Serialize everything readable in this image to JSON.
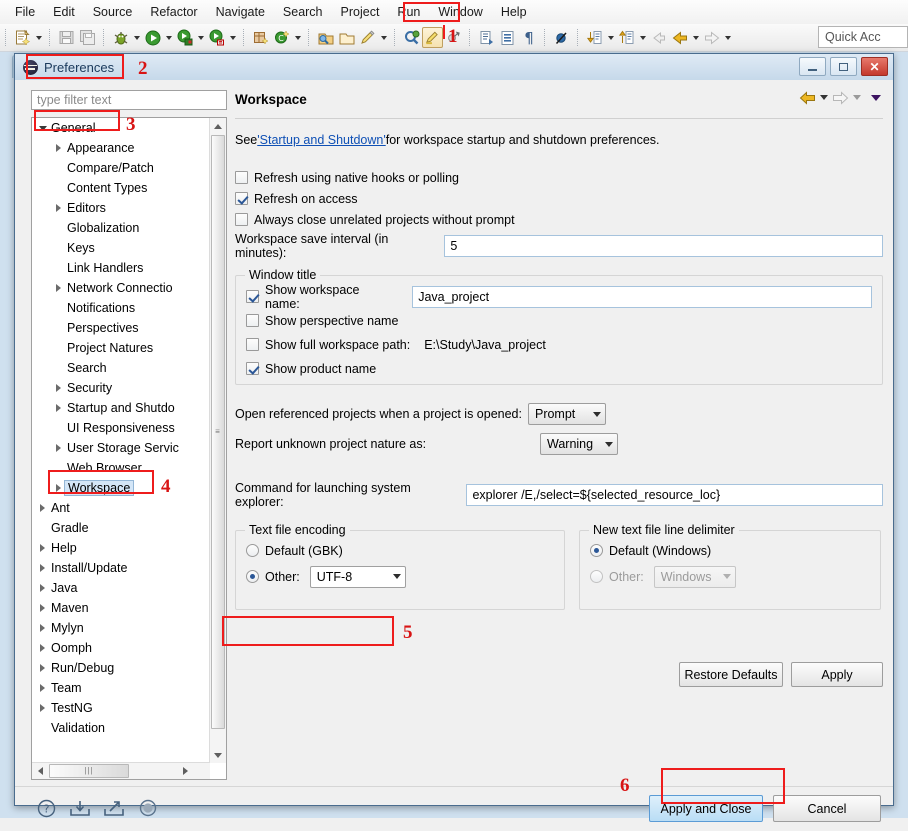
{
  "app": {
    "menubar": [
      "File",
      "Edit",
      "Source",
      "Refactor",
      "Navigate",
      "Search",
      "Project",
      "Run",
      "Window",
      "Help"
    ],
    "quick_access": "Quick Acc"
  },
  "dialog": {
    "title": "Preferences",
    "logo_icon": "eclipse-logo-icon",
    "minimize_label": "minimize-icon",
    "maximize_label": "maximize-icon",
    "close_label": "✕"
  },
  "filter": {
    "placeholder": "type filter text",
    "value": ""
  },
  "tree": {
    "items": [
      {
        "label": "General",
        "indent": 0,
        "arrow": "open",
        "selected": false
      },
      {
        "label": "Appearance",
        "indent": 1,
        "arrow": "closed",
        "selected": false
      },
      {
        "label": "Compare/Patch",
        "indent": 1,
        "arrow": "none",
        "selected": false
      },
      {
        "label": "Content Types",
        "indent": 1,
        "arrow": "none",
        "selected": false
      },
      {
        "label": "Editors",
        "indent": 1,
        "arrow": "closed",
        "selected": false
      },
      {
        "label": "Globalization",
        "indent": 1,
        "arrow": "none",
        "selected": false
      },
      {
        "label": "Keys",
        "indent": 1,
        "arrow": "none",
        "selected": false
      },
      {
        "label": "Link Handlers",
        "indent": 1,
        "arrow": "none",
        "selected": false
      },
      {
        "label": "Network Connectio",
        "indent": 1,
        "arrow": "closed",
        "selected": false
      },
      {
        "label": "Notifications",
        "indent": 1,
        "arrow": "none",
        "selected": false
      },
      {
        "label": "Perspectives",
        "indent": 1,
        "arrow": "none",
        "selected": false
      },
      {
        "label": "Project Natures",
        "indent": 1,
        "arrow": "none",
        "selected": false
      },
      {
        "label": "Search",
        "indent": 1,
        "arrow": "none",
        "selected": false
      },
      {
        "label": "Security",
        "indent": 1,
        "arrow": "closed",
        "selected": false
      },
      {
        "label": "Startup and Shutdo",
        "indent": 1,
        "arrow": "closed",
        "selected": false
      },
      {
        "label": "UI Responsiveness",
        "indent": 1,
        "arrow": "none",
        "selected": false
      },
      {
        "label": "User Storage Servic",
        "indent": 1,
        "arrow": "closed",
        "selected": false
      },
      {
        "label": "Web Browser",
        "indent": 1,
        "arrow": "none",
        "selected": false
      },
      {
        "label": "Workspace",
        "indent": 1,
        "arrow": "closed",
        "selected": true
      },
      {
        "label": "Ant",
        "indent": 0,
        "arrow": "closed",
        "selected": false
      },
      {
        "label": "Gradle",
        "indent": 0,
        "arrow": "none",
        "selected": false
      },
      {
        "label": "Help",
        "indent": 0,
        "arrow": "closed",
        "selected": false
      },
      {
        "label": "Install/Update",
        "indent": 0,
        "arrow": "closed",
        "selected": false
      },
      {
        "label": "Java",
        "indent": 0,
        "arrow": "closed",
        "selected": false
      },
      {
        "label": "Maven",
        "indent": 0,
        "arrow": "closed",
        "selected": false
      },
      {
        "label": "Mylyn",
        "indent": 0,
        "arrow": "closed",
        "selected": false
      },
      {
        "label": "Oomph",
        "indent": 0,
        "arrow": "closed",
        "selected": false
      },
      {
        "label": "Run/Debug",
        "indent": 0,
        "arrow": "closed",
        "selected": false
      },
      {
        "label": "Team",
        "indent": 0,
        "arrow": "closed",
        "selected": false
      },
      {
        "label": "TestNG",
        "indent": 0,
        "arrow": "closed",
        "selected": false
      },
      {
        "label": "Validation",
        "indent": 0,
        "arrow": "none",
        "selected": false
      }
    ]
  },
  "page": {
    "title": "Workspace",
    "intro_before": "See ",
    "intro_link": "'Startup and Shutdown'",
    "intro_after": " for workspace startup and shutdown preferences.",
    "checkboxes": [
      {
        "label": "Refresh using native hooks or polling",
        "checked": false
      },
      {
        "label": "Refresh on access",
        "checked": true
      },
      {
        "label": "Always close unrelated projects without prompt",
        "checked": false
      }
    ],
    "save_interval_label": "Workspace save interval (in minutes):",
    "save_interval_value": "5",
    "window_title_group": {
      "legend": "Window title",
      "show_workspace_name_label": "Show workspace name:",
      "show_workspace_name_checked": true,
      "workspace_name_value": "Java_project",
      "show_perspective_name_label": "Show perspective name",
      "show_perspective_name_checked": false,
      "show_full_path_label": "Show full workspace path:",
      "show_full_path_checked": false,
      "full_path_value": "E:\\Study\\Java_project",
      "show_product_name_label": "Show product name",
      "show_product_name_checked": true
    },
    "open_referenced_label": "Open referenced projects when a project is opened:",
    "open_referenced_value": "Prompt",
    "report_nature_label": "Report unknown project nature as:",
    "report_nature_value": "Warning",
    "command_label": "Command for launching system explorer:",
    "command_value": "explorer /E,/select=${selected_resource_loc}",
    "encoding_group": {
      "legend": "Text file encoding",
      "default_label": "Default (GBK)",
      "default_selected": false,
      "other_label": "Other:",
      "other_selected": true,
      "other_value": "UTF-8"
    },
    "delimiter_group": {
      "legend": "New text file line delimiter",
      "default_label": "Default (Windows)",
      "default_selected": true,
      "other_label": "Other:",
      "other_selected": false,
      "other_value": "Windows"
    }
  },
  "buttons": {
    "restore_defaults": "Restore Defaults",
    "apply": "Apply",
    "apply_and_close": "Apply and Close",
    "cancel": "Cancel"
  },
  "footer_icons": [
    {
      "name": "help-icon",
      "glyph": "?"
    },
    {
      "name": "import-preferences-icon",
      "glyph": "↙"
    },
    {
      "name": "export-preferences-icon",
      "glyph": "↗"
    },
    {
      "name": "oomph-recorder-icon",
      "glyph": "◉"
    }
  ],
  "annotations": [
    {
      "number": "1"
    },
    {
      "number": "2"
    },
    {
      "number": "3"
    },
    {
      "number": "4"
    },
    {
      "number": "5"
    },
    {
      "number": "6"
    }
  ],
  "colors": {
    "annotation_red": "#ee1c1c",
    "link_blue": "#0f50b5",
    "selection_blue": "#d4e6f7",
    "title_gradient_top": "#dfeaf5"
  }
}
